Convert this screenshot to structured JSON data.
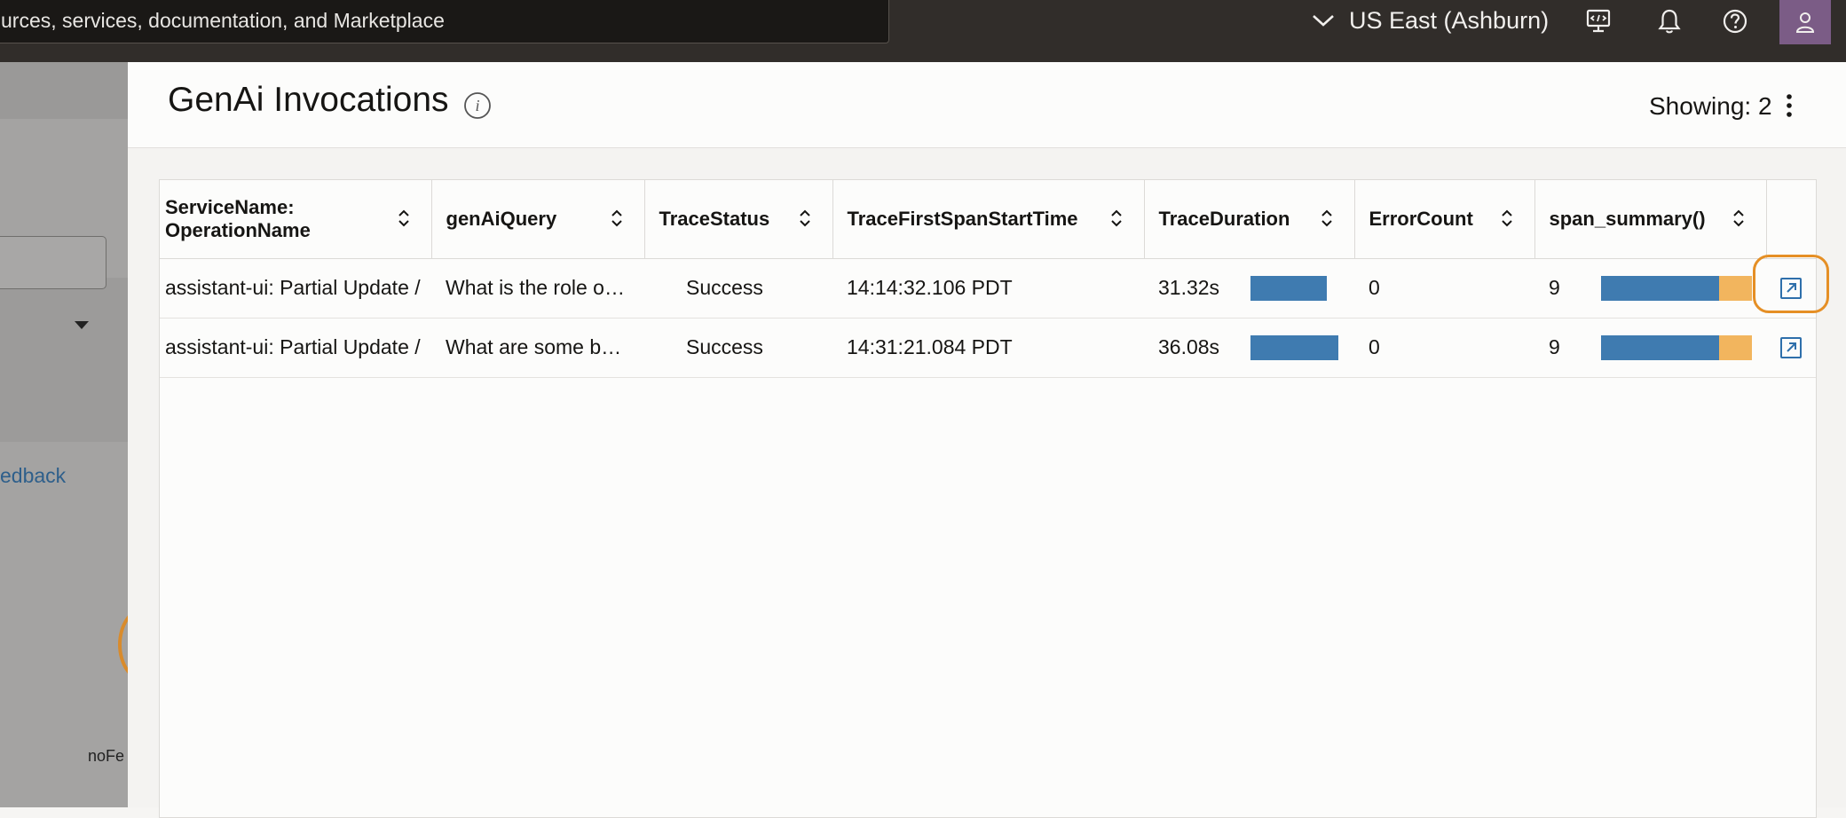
{
  "topbar": {
    "search_text": "urces, services, documentation, and Marketplace",
    "region_label": "US East (Ashburn)",
    "icons": [
      "chevron-down-icon",
      "cloud-shell-icon",
      "bell-icon",
      "help-icon",
      "user-icon"
    ]
  },
  "left": {
    "feedback_text": "edback",
    "nofe_text": "noFe"
  },
  "panel": {
    "title": "GenAi Invocations",
    "showing": "Showing: 2"
  },
  "table": {
    "columns": [
      "ServiceName: OperationName",
      "genAiQuery",
      "TraceStatus",
      "TraceFirstSpanStartTime",
      "TraceDuration",
      "ErrorCount",
      "span_summary()"
    ],
    "rows": [
      {
        "service": "assistant-ui: Partial Update /",
        "query": "What is the role of…",
        "status": "Success",
        "start": "14:14:32.106 PDT",
        "duration": "31.32s",
        "duration_seconds": 31.32,
        "errors": "0",
        "spans": "9",
        "span_summary_blue_fraction": 0.78
      },
      {
        "service": "assistant-ui: Partial Update /",
        "query": "What are some be…",
        "status": "Success",
        "start": "14:31:21.084 PDT",
        "duration": "36.08s",
        "duration_seconds": 36.08,
        "errors": "0",
        "spans": "9",
        "span_summary_blue_fraction": 0.78
      }
    ]
  },
  "colors": {
    "duration_bar": "#3f7bb0",
    "span_blue": "#3f7bb0",
    "span_orange": "#f2b55e",
    "highlight": "#e58f25",
    "topbar_bg": "#312d2a"
  }
}
